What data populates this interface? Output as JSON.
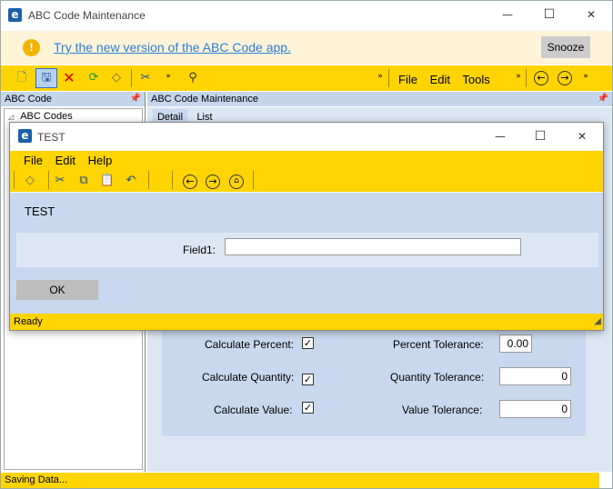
{
  "main_window": {
    "title": "ABC Code Maintenance",
    "controls": {
      "minimize": "—",
      "maximize": "☐",
      "close": "✕"
    }
  },
  "banner": {
    "message": "Try the new version of the ABC Code app.",
    "snooze": "Snooze",
    "icon": "!"
  },
  "toolbar": {
    "menu": [
      "File",
      "Edit",
      "Tools"
    ],
    "icons": [
      "new-icon",
      "save-icon",
      "delete-icon",
      "refresh-icon",
      "clear-icon",
      "cut-icon",
      "find-icon",
      "back-icon",
      "forward-icon"
    ]
  },
  "left_pane": {
    "title": "ABC Code",
    "tree_root": "ABC Codes"
  },
  "right_pane": {
    "title": "ABC Code Maintenance",
    "tabs": [
      "Detail",
      "List"
    ]
  },
  "form": {
    "calc_percent_label": "Calculate Percent:",
    "calc_quantity_label": "Calculate Quantity:",
    "calc_value_label": "Calculate Value:",
    "percent_tol_label": "Percent Tolerance:",
    "quantity_tol_label": "Quantity Tolerance:",
    "value_tol_label": "Value Tolerance:",
    "percent_tol_value": "0.00",
    "quantity_tol_value": "0",
    "value_tol_value": "0",
    "check_mark": "✓"
  },
  "status_bar": {
    "text": "Saving Data..."
  },
  "dialog": {
    "title": "TEST",
    "menu": [
      "File",
      "Edit",
      "Help"
    ],
    "heading": "TEST",
    "field1_label": "Field1:",
    "field1_value": "",
    "ok_label": "OK",
    "status": "Ready",
    "controls": {
      "minimize": "—",
      "maximize": "☐",
      "close": "✕"
    }
  },
  "colors": {
    "accent_yellow": "#ffd400",
    "banner_bg": "#fdf3d7",
    "pane_header": "#c5d6ec",
    "panel_bg": "#c8d8ee"
  }
}
